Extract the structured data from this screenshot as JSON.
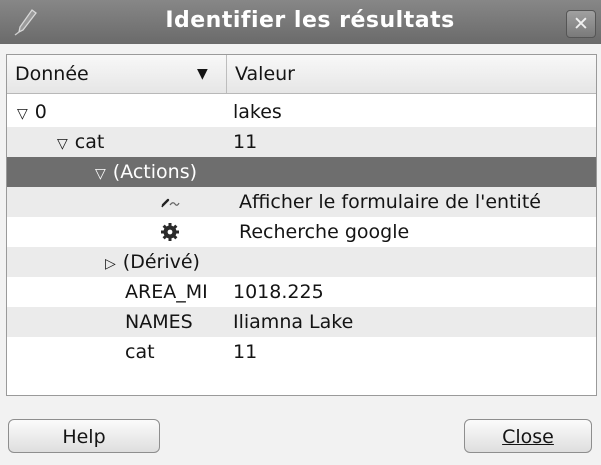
{
  "window": {
    "title": "Identifier les résultats",
    "close_glyph": "✕"
  },
  "columns": {
    "data_header": "Donnée",
    "value_header": "Valeur"
  },
  "tree": {
    "root": {
      "label": "0",
      "value": "lakes",
      "expanded": true
    },
    "cat": {
      "label": "cat",
      "value": "11",
      "expanded": true
    },
    "actions": {
      "label": "(Actions)",
      "expanded": true,
      "selected": true
    },
    "action_form": {
      "icon": "edit-form-icon",
      "value": "Afficher le formulaire de l'entité"
    },
    "action_google": {
      "icon": "gear-icon",
      "value": "Recherche google"
    },
    "derived": {
      "label": "(Dérivé)",
      "expanded": false
    },
    "attr_area": {
      "label": "AREA_MI",
      "value": "1018.225"
    },
    "attr_names": {
      "label": "NAMES",
      "value": "Iliamna Lake"
    },
    "attr_cat": {
      "label": "cat",
      "value": "11"
    }
  },
  "buttons": {
    "help": "Help",
    "close": "Close"
  },
  "colors": {
    "titlebar": "#777777",
    "selection": "#6e6e6e",
    "alt_row": "#ebebeb"
  }
}
